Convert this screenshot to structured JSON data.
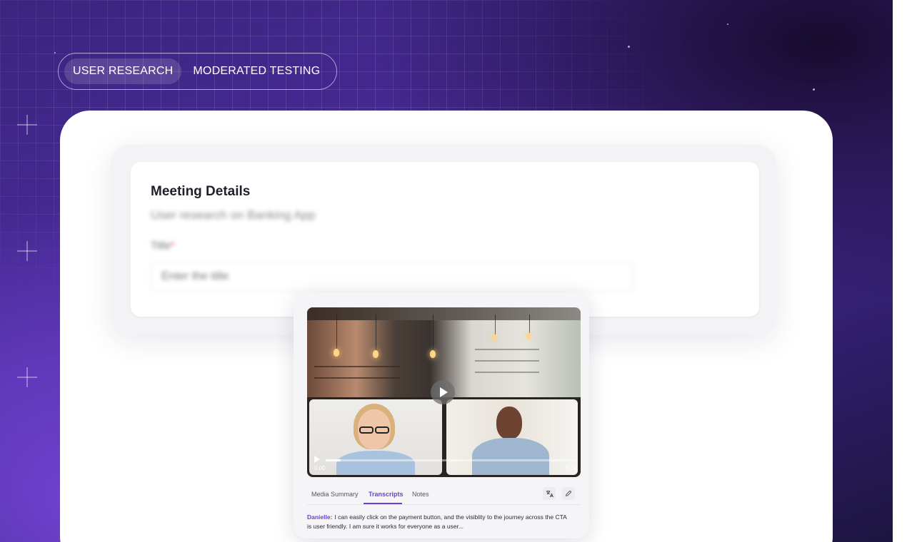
{
  "chips": [
    {
      "label": "USER RESEARCH",
      "active": true
    },
    {
      "label": "MODERATED TESTING",
      "active": false
    }
  ],
  "meeting": {
    "title": "Meeting Details",
    "subtitle": "User research on Banking App",
    "field_label": "Title",
    "required_mark": "*",
    "placeholder": "Enter the title"
  },
  "player": {
    "current_time": "0:00",
    "duration": "8:24",
    "progress_percent": 6
  },
  "media_tabs": [
    {
      "label": "Media Summary",
      "active": false
    },
    {
      "label": "Transcripts",
      "active": true
    },
    {
      "label": "Notes",
      "active": false
    }
  ],
  "tool_icons": [
    "translate-icon",
    "pencil-icon"
  ],
  "transcript": {
    "speaker": "Danielle:",
    "text": "I can easily click on the payment button, and the visiblity to the journey across the CTA is user friendly. I am sure it works for everyone as a user..."
  },
  "colors": {
    "accent": "#6b3fd4",
    "background": "#3a2580",
    "required": "#e5484d"
  }
}
